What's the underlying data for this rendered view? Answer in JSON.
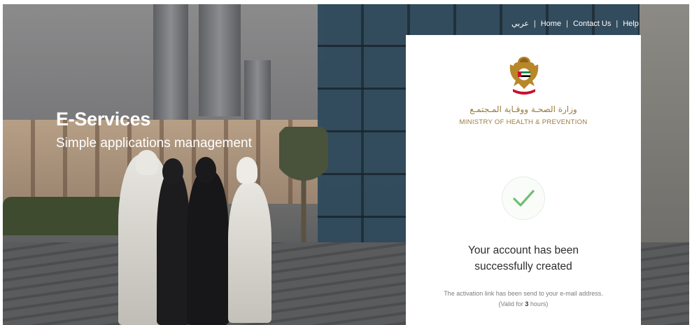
{
  "nav": {
    "arabic": "عربي",
    "separator": "|",
    "home": "Home",
    "contact": "Contact Us",
    "help": "Help"
  },
  "hero": {
    "title": "E-Services",
    "subtitle": "Simple applications management"
  },
  "ministry": {
    "arabic_name": "وزارة الصحـة ووقـاية المـجتمـع",
    "english_name": "MINISTRY OF HEALTH & PREVENTION"
  },
  "status": {
    "line1": "Your account has been",
    "line2": "successfully created",
    "note_line1": "The activation link has been send to your e-mail address.",
    "note_prefix": "(Valid for ",
    "note_hours": "3",
    "note_suffix": " hours)"
  },
  "colors": {
    "gold": "#9a7b3b",
    "check_green": "#6cc06f"
  },
  "icons": {
    "emblem": "uae-emblem-icon",
    "success": "check-icon"
  }
}
